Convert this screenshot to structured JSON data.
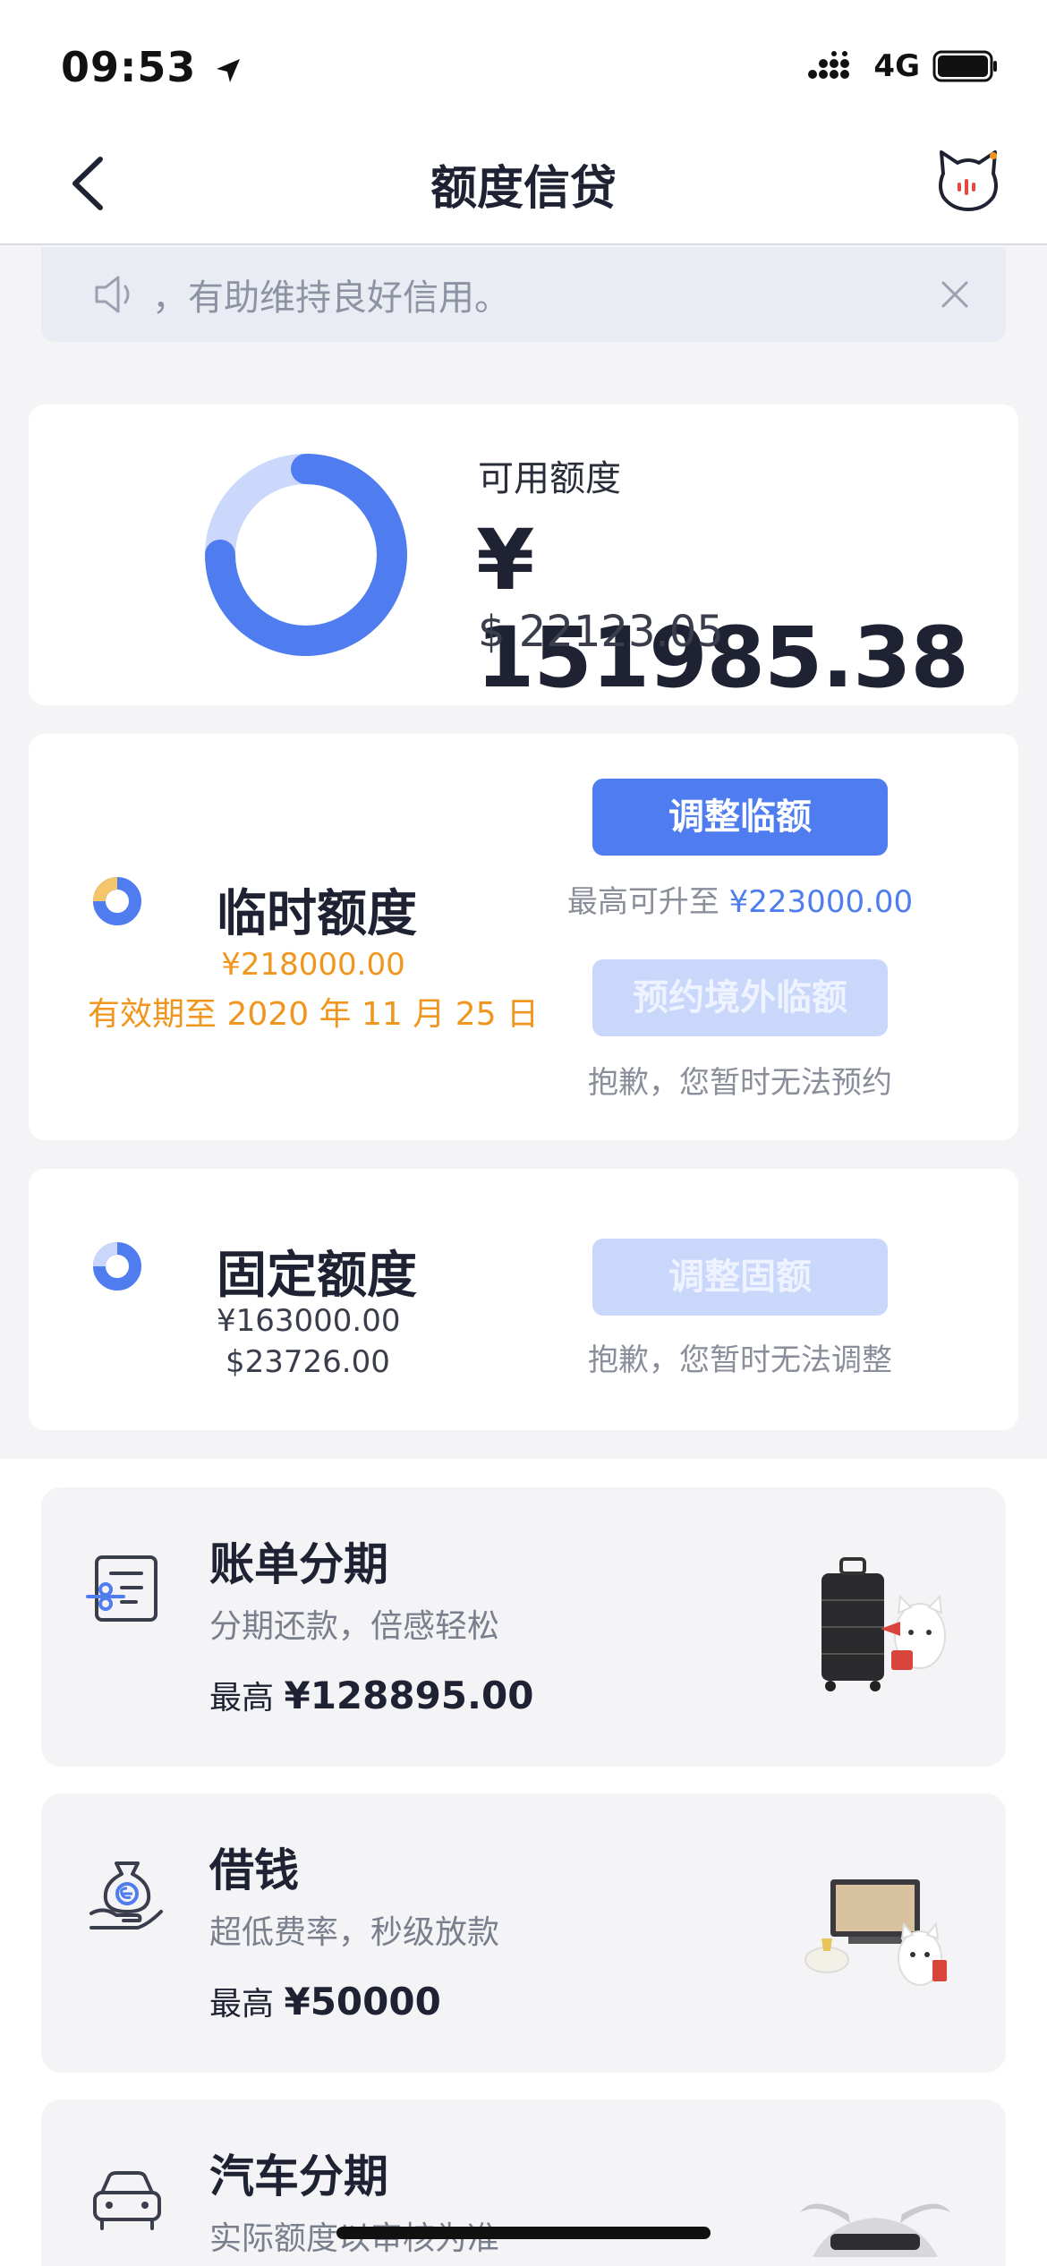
{
  "status_bar": {
    "time": "09:53",
    "network": "4G"
  },
  "nav": {
    "title": "额度信贷"
  },
  "notice": {
    "text": "，有助维持良好信用。"
  },
  "available": {
    "label": "可用额度",
    "amount_cny": "¥ 151985.38",
    "amount_usd": "$ 22123.05",
    "used_fraction": 0.25
  },
  "temporary": {
    "title": "临时额度",
    "amount": "¥218000.00",
    "valid_until": "有效期至 2020 年 11 月 25 日",
    "adjust_button": "调整临额",
    "max_prefix": "最高可升至",
    "max_value": "¥223000.00",
    "overseas_button": "预约境外临额",
    "overseas_hint": "抱歉，您暂时无法预约"
  },
  "fixed": {
    "title": "固定额度",
    "amount_cny": "¥163000.00",
    "amount_usd": "$23726.00",
    "adjust_button": "调整固额",
    "hint": "抱歉，您暂时无法调整"
  },
  "services": [
    {
      "title": "账单分期",
      "subtitle": "分期还款，倍感轻松",
      "max_prefix": "最高",
      "max_value": "¥128895.00"
    },
    {
      "title": "借钱",
      "subtitle": "超低费率，秒级放款",
      "max_prefix": "最高",
      "max_value": "¥50000"
    },
    {
      "title": "汽车分期",
      "subtitle": "实际额度以审核为准"
    }
  ],
  "colors": {
    "accent": "#4f7df0",
    "accent_light": "#c9d7fb",
    "warning": "#f0961e"
  }
}
